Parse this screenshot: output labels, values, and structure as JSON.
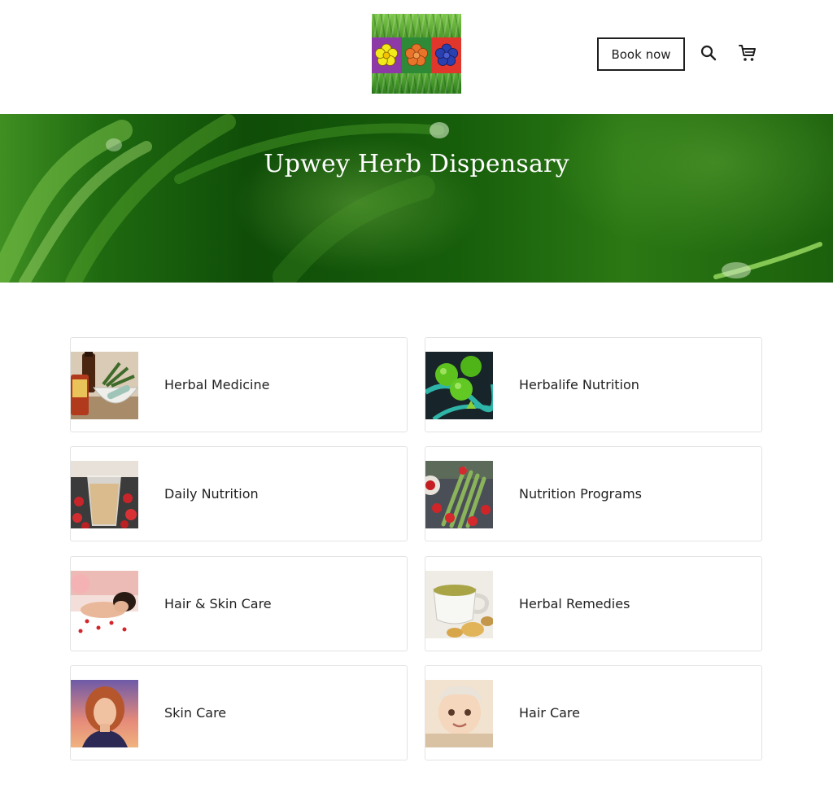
{
  "header": {
    "book_label": "Book now",
    "icons": {
      "search": "search-icon",
      "cart": "cart-icon"
    },
    "logo_colors": [
      "#e0ef1a",
      "#e8742a",
      "#2a3fb0"
    ],
    "logo_tile_colors": [
      "#8d3aa6",
      "#2e8a36",
      "#e0362c"
    ]
  },
  "hero": {
    "title": "Upwey Herb Dispensary"
  },
  "categories": [
    {
      "label": "Herbal Medicine"
    },
    {
      "label": "Herbalife Nutrition"
    },
    {
      "label": "Daily Nutrition"
    },
    {
      "label": "Nutrition Programs"
    },
    {
      "label": "Hair & Skin Care"
    },
    {
      "label": "Herbal Remedies"
    },
    {
      "label": "Skin Care"
    },
    {
      "label": "Hair Care"
    }
  ]
}
